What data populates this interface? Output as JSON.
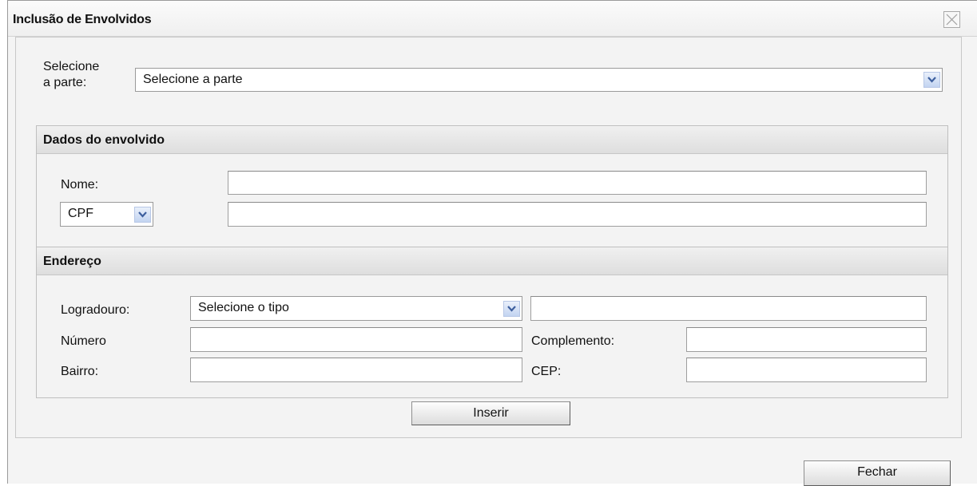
{
  "dialog": {
    "title": "Inclusão de Envolvidos"
  },
  "parte": {
    "label_line1": "Selecione",
    "label_line2": "a parte:",
    "selected": "Selecione a parte"
  },
  "dados": {
    "heading": "Dados do envolvido",
    "nome_label": "Nome:",
    "nome_value": "",
    "doc_type_selected": "CPF",
    "doc_value": ""
  },
  "endereco": {
    "heading": "Endereço",
    "logradouro_label": "Logradouro:",
    "logradouro_tipo_selected": "Selecione o tipo",
    "logradouro_value": "",
    "numero_label": "Número",
    "numero_value": "",
    "complemento_label": "Complemento:",
    "complemento_value": "",
    "bairro_label": "Bairro:",
    "bairro_value": "",
    "cep_label": "CEP:",
    "cep_value": ""
  },
  "buttons": {
    "inserir": "Inserir",
    "fechar": "Fechar"
  },
  "icons": {
    "close": "close-icon",
    "dropdown": "chevron-down-icon"
  },
  "colors": {
    "dropdown_arrow": "#3d5f9e",
    "dropdown_bg": "#c3d4f1"
  }
}
